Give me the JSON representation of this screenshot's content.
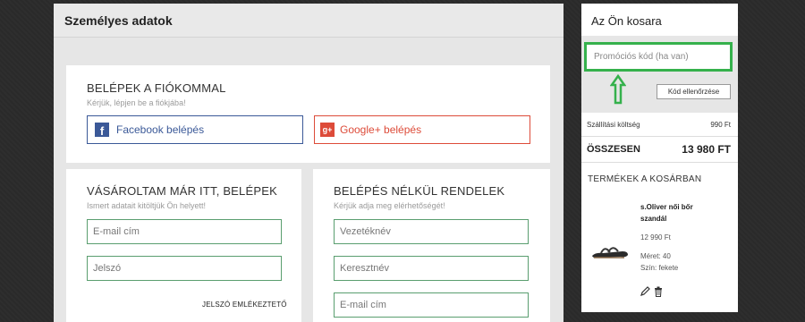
{
  "personal": {
    "title": "Személyes adatok",
    "login_card": {
      "title": "BELÉPEK A FIÓKOMMAL",
      "subtitle": "Kérjük, lépjen be a fiókjába!",
      "facebook_label": "Facebook belépés",
      "google_label": "Google+ belépés"
    },
    "bought_card": {
      "title": "VÁSÁROLTAM MÁR ITT, BELÉPEK",
      "subtitle": "Ismert adatait kitöltjük Ön helyett!",
      "email_placeholder": "E-mail cím",
      "password_placeholder": "Jelszó",
      "reminder_link": "JELSZÓ EMLÉKEZTETŐ"
    },
    "guest_card": {
      "title": "BELÉPÉS NÉLKÜL RENDELEK",
      "subtitle": "Kérjük adja meg elérhetőségét!",
      "lastname_placeholder": "Vezetéknév",
      "firstname_placeholder": "Keresztnév",
      "email_placeholder": "E-mail cím"
    }
  },
  "cart": {
    "title": "Az Ön kosara",
    "promo_placeholder": "Promóciós kód (ha van)",
    "check_code_label": "Kód ellenőrzése",
    "shipping_label": "Szállítási költség",
    "shipping_value": "990 Ft",
    "total_label": "ÖSSZESEN",
    "total_value": "13 980 FT",
    "products_title": "TERMÉKEK A KOSÁRBAN",
    "product": {
      "name": "s.Oliver női bőr szandál",
      "price": "12 990 Ft",
      "size": "Méret: 40",
      "color": "Szín: fekete"
    }
  },
  "colors": {
    "accent_green": "#35b14c",
    "facebook": "#3b5998",
    "google": "#dd4b39"
  }
}
